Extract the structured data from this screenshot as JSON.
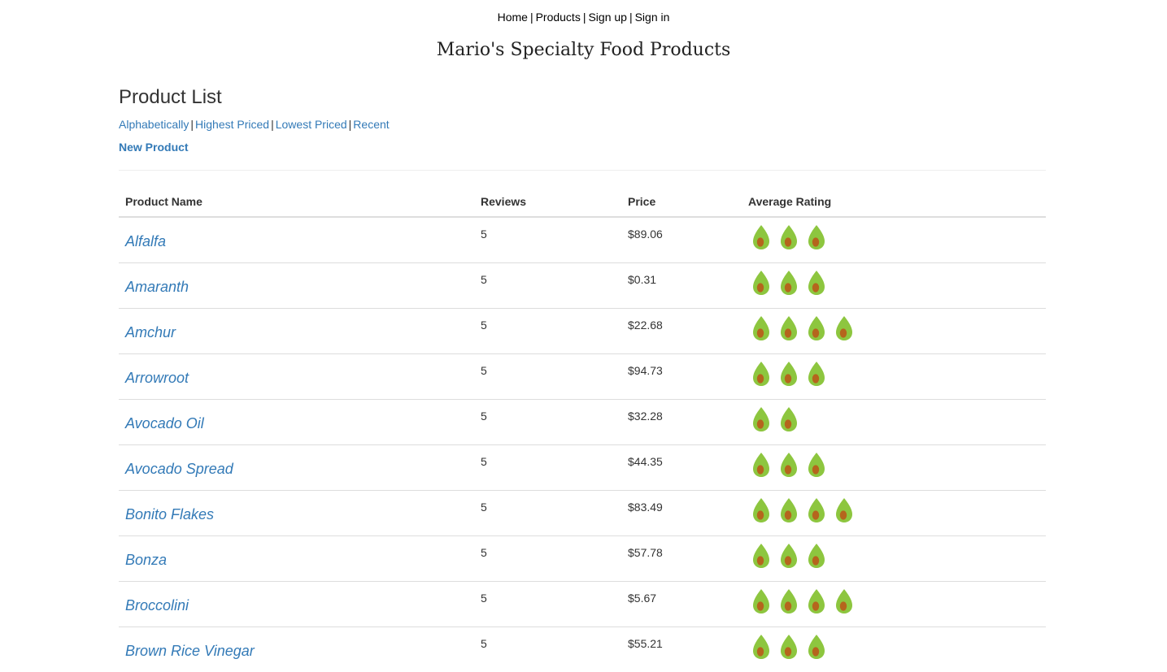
{
  "nav": {
    "items": [
      "Home",
      "Products",
      "Sign up",
      "Sign in"
    ]
  },
  "site_title": "Mario's Specialty Food Products",
  "page_title": "Product List",
  "sort_links": [
    "Alphabetically",
    "Highest Priced",
    "Lowest Priced",
    "Recent"
  ],
  "new_product_label": "New Product",
  "table": {
    "headers": [
      "Product Name",
      "Reviews",
      "Price",
      "Average Rating"
    ],
    "rows": [
      {
        "name": "Alfalfa",
        "reviews": "5",
        "price": "$89.06",
        "rating": 3
      },
      {
        "name": "Amaranth",
        "reviews": "5",
        "price": "$0.31",
        "rating": 3
      },
      {
        "name": "Amchur",
        "reviews": "5",
        "price": "$22.68",
        "rating": 4
      },
      {
        "name": "Arrowroot",
        "reviews": "5",
        "price": "$94.73",
        "rating": 3
      },
      {
        "name": "Avocado Oil",
        "reviews": "5",
        "price": "$32.28",
        "rating": 2
      },
      {
        "name": "Avocado Spread",
        "reviews": "5",
        "price": "$44.35",
        "rating": 3
      },
      {
        "name": "Bonito Flakes",
        "reviews": "5",
        "price": "$83.49",
        "rating": 4
      },
      {
        "name": "Bonza",
        "reviews": "5",
        "price": "$57.78",
        "rating": 3
      },
      {
        "name": "Broccolini",
        "reviews": "5",
        "price": "$5.67",
        "rating": 4
      },
      {
        "name": "Brown Rice Vinegar",
        "reviews": "5",
        "price": "$55.21",
        "rating": 3
      }
    ]
  },
  "rating_icon": "avocado-icon",
  "colors": {
    "link": "#337ab7",
    "avocado_skin": "#8dc63f",
    "avocado_pit": "#b5651d"
  }
}
